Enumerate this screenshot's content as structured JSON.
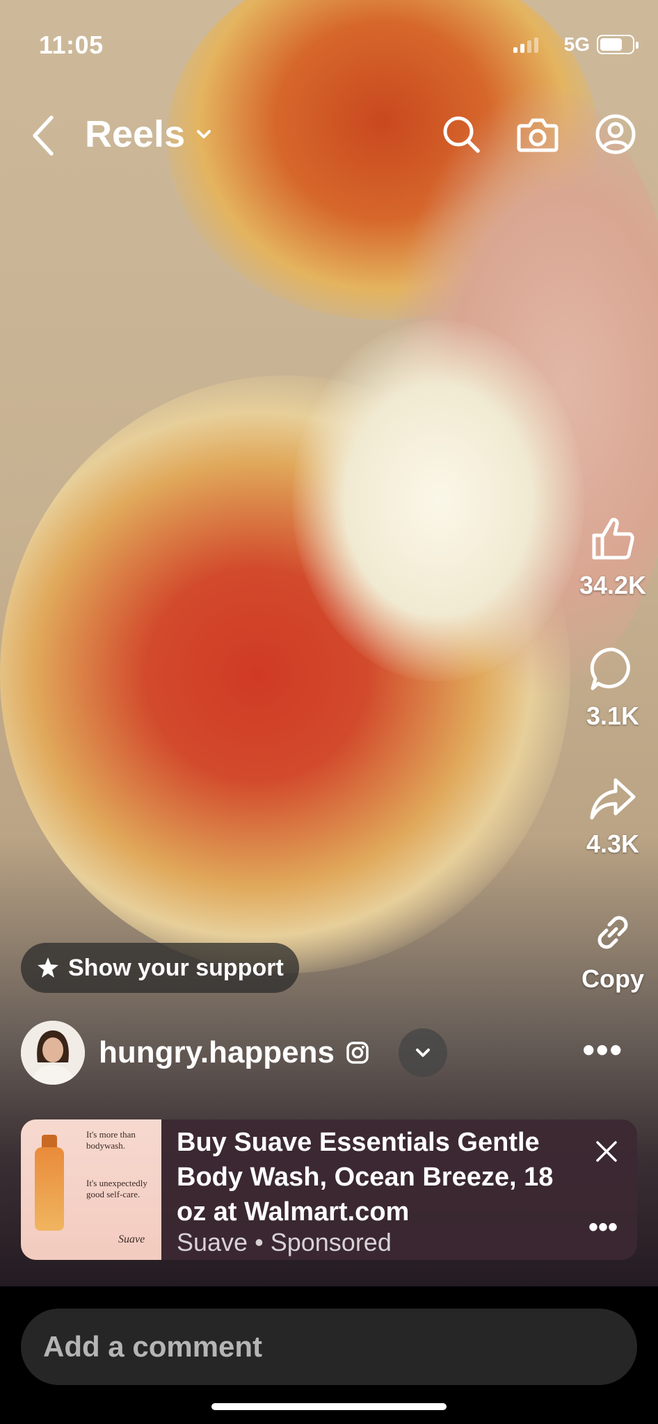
{
  "status_bar": {
    "time": "11:05",
    "network": "5G"
  },
  "header": {
    "title": "Reels"
  },
  "actions": {
    "likes": "34.2K",
    "comments": "3.1K",
    "shares": "4.3K",
    "copy_label": "Copy"
  },
  "support_button": {
    "label": "Show your support"
  },
  "user": {
    "username": "hungry.happens"
  },
  "ad": {
    "title": "Buy Suave Essentials Gentle Body Wash, Ocean Breeze, 18 oz at Walmart.com",
    "advertiser": "Suave",
    "separator": "•",
    "sponsored": "Sponsored",
    "thumb_line1": "It's more than bodywash.",
    "thumb_line2": "It's unexpectedly good self-care.",
    "thumb_brand": "Suave"
  },
  "comment": {
    "placeholder": "Add a comment"
  },
  "colors": {
    "background": "#000000",
    "comment_bg": "#262626",
    "ad_bg": "#3c2832"
  }
}
